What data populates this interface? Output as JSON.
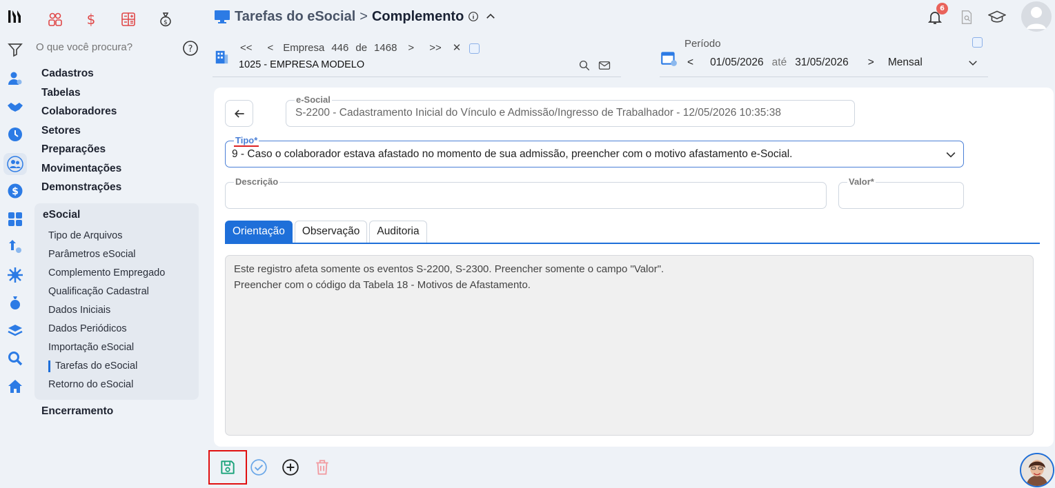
{
  "header": {
    "section_title": "Tarefas do eSocial",
    "separator": ">",
    "page_title": "Complemento",
    "notification_count": "6"
  },
  "search": {
    "placeholder": "O que você procura?"
  },
  "menu": {
    "items_top": [
      "Cadastros",
      "Tabelas",
      "Colaboradores",
      "Setores",
      "Preparações",
      "Movimentações",
      "Demonstrações"
    ],
    "esocial_header": "eSocial",
    "esocial_items": [
      "Tipo de Arquivos",
      "Parâmetros eSocial",
      "Complemento Empregado",
      "Qualificação Cadastral",
      "Dados Iniciais",
      "Dados Periódicos",
      "Importação eSocial",
      "Tarefas do eSocial",
      "Retorno do eSocial"
    ],
    "active_item": "Tarefas do eSocial",
    "items_bottom": [
      "Encerramento"
    ]
  },
  "company": {
    "label": "Empresa",
    "index": "446",
    "of_label": "de",
    "total": "1468",
    "name": "1025 - EMPRESA MODELO"
  },
  "period": {
    "label": "Período",
    "start": "01/05/2026",
    "until_label": "até",
    "end": "31/05/2026",
    "frequency": "Mensal"
  },
  "form": {
    "esocial_label": "e-Social",
    "esocial_value": "S-2200 - Cadastramento Inicial do Vínculo e Admissão/Ingresso de Trabalhador - 12/05/2026 10:35:38",
    "tipo_label": "Tipo*",
    "tipo_value": "9 - Caso o colaborador estava afastado no momento de sua admissão, preencher com o motivo afastamento e-Social.",
    "descricao_label": "Descrição",
    "descricao_value": "",
    "valor_label": "Valor*",
    "valor_value": ""
  },
  "tabs": [
    "Orientação",
    "Observação",
    "Auditoria"
  ],
  "orientation": {
    "line1": "Este registro afeta somente os eventos S-2200, S-2300. Preencher somente o campo \"Valor\".",
    "line2": "Preencher com o código da Tabela 18 - Motivos de Afastamento."
  },
  "colors": {
    "accent": "#1e6fd9",
    "highlight": "#e01010",
    "save": "#1aa37a",
    "danger": "#f29aa0"
  }
}
